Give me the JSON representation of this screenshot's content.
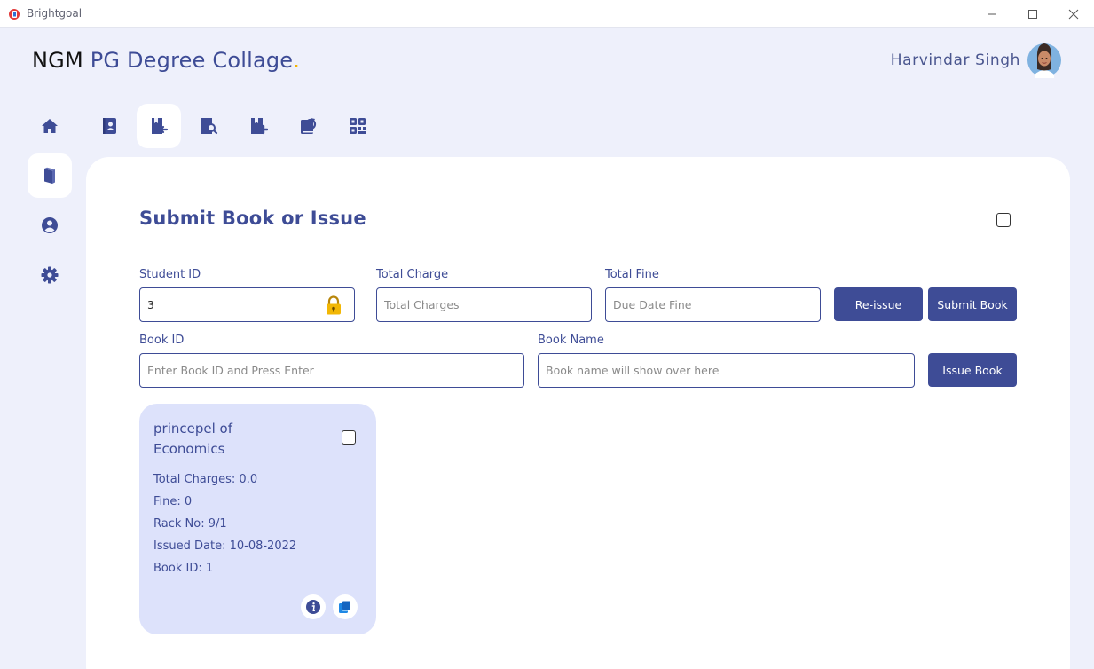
{
  "window": {
    "title": "Brightgoal"
  },
  "header": {
    "brand_part1": "NGM",
    "brand_part2": "PG Degree Collage",
    "brand_dot": ".",
    "user_name": "Harvindar Singh"
  },
  "side_nav": {
    "items": [
      {
        "name": "home",
        "icon": "home-icon"
      },
      {
        "name": "books",
        "icon": "book-icon",
        "active": true
      },
      {
        "name": "profile",
        "icon": "user-circle-icon"
      },
      {
        "name": "settings",
        "icon": "gear-icon"
      }
    ]
  },
  "top_nav": {
    "items": [
      {
        "name": "student-book",
        "icon": "book-user-icon"
      },
      {
        "name": "submit-book",
        "icon": "book-return-icon",
        "active": true
      },
      {
        "name": "search-book",
        "icon": "book-search-icon"
      },
      {
        "name": "add-book",
        "icon": "book-add-icon"
      },
      {
        "name": "renew-book",
        "icon": "book-refresh-icon"
      },
      {
        "name": "qr-code",
        "icon": "qr-code-icon"
      }
    ]
  },
  "main": {
    "title": "Submit Book or Issue",
    "student_id": {
      "label": "Student ID",
      "value": "3"
    },
    "total_charge": {
      "label": "Total Charge",
      "placeholder": "Total Charges"
    },
    "total_fine": {
      "label": "Total Fine",
      "placeholder": "Due Date Fine"
    },
    "book_id": {
      "label": "Book ID",
      "placeholder": "Enter Book ID and Press Enter"
    },
    "book_name": {
      "label": "Book Name",
      "placeholder": "Book name will show over here"
    },
    "buttons": {
      "reissue": "Re-issue",
      "submit": "Submit Book",
      "issue": "Issue Book"
    }
  },
  "book_card": {
    "title": "princepel of Economics",
    "total_charges": "Total Charges: 0.0",
    "fine": "Fine: 0",
    "rack": "Rack No: 9/1",
    "issued_date": "Issued Date: 10-08-2022",
    "book_id": "Book ID: 1"
  },
  "colors": {
    "accent": "#3e4c96",
    "background": "#eef0fb",
    "card": "#dde2fb",
    "brand_dot": "#f5b400",
    "lock": "#f2b705"
  }
}
